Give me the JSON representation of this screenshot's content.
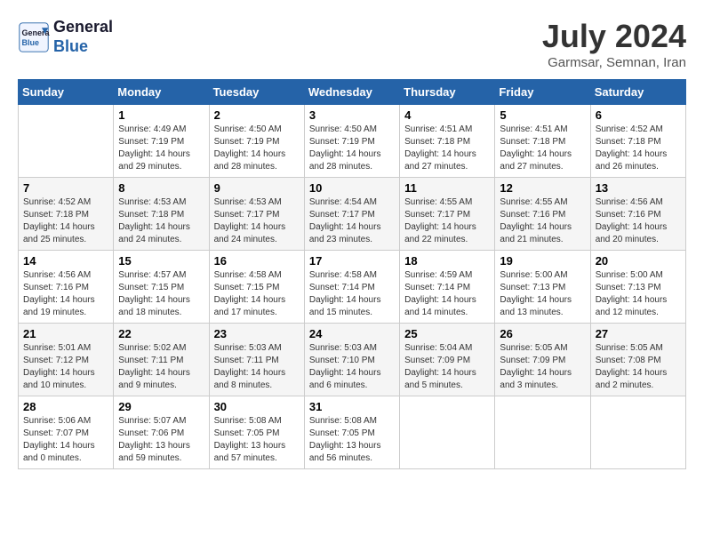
{
  "header": {
    "logo_line1": "General",
    "logo_line2": "Blue",
    "month_title": "July 2024",
    "location": "Garmsar, Semnan, Iran"
  },
  "weekdays": [
    "Sunday",
    "Monday",
    "Tuesday",
    "Wednesday",
    "Thursday",
    "Friday",
    "Saturday"
  ],
  "weeks": [
    [
      {
        "day": "",
        "info": ""
      },
      {
        "day": "1",
        "info": "Sunrise: 4:49 AM\nSunset: 7:19 PM\nDaylight: 14 hours\nand 29 minutes."
      },
      {
        "day": "2",
        "info": "Sunrise: 4:50 AM\nSunset: 7:19 PM\nDaylight: 14 hours\nand 28 minutes."
      },
      {
        "day": "3",
        "info": "Sunrise: 4:50 AM\nSunset: 7:19 PM\nDaylight: 14 hours\nand 28 minutes."
      },
      {
        "day": "4",
        "info": "Sunrise: 4:51 AM\nSunset: 7:18 PM\nDaylight: 14 hours\nand 27 minutes."
      },
      {
        "day": "5",
        "info": "Sunrise: 4:51 AM\nSunset: 7:18 PM\nDaylight: 14 hours\nand 27 minutes."
      },
      {
        "day": "6",
        "info": "Sunrise: 4:52 AM\nSunset: 7:18 PM\nDaylight: 14 hours\nand 26 minutes."
      }
    ],
    [
      {
        "day": "7",
        "info": "Sunrise: 4:52 AM\nSunset: 7:18 PM\nDaylight: 14 hours\nand 25 minutes."
      },
      {
        "day": "8",
        "info": "Sunrise: 4:53 AM\nSunset: 7:18 PM\nDaylight: 14 hours\nand 24 minutes."
      },
      {
        "day": "9",
        "info": "Sunrise: 4:53 AM\nSunset: 7:17 PM\nDaylight: 14 hours\nand 24 minutes."
      },
      {
        "day": "10",
        "info": "Sunrise: 4:54 AM\nSunset: 7:17 PM\nDaylight: 14 hours\nand 23 minutes."
      },
      {
        "day": "11",
        "info": "Sunrise: 4:55 AM\nSunset: 7:17 PM\nDaylight: 14 hours\nand 22 minutes."
      },
      {
        "day": "12",
        "info": "Sunrise: 4:55 AM\nSunset: 7:16 PM\nDaylight: 14 hours\nand 21 minutes."
      },
      {
        "day": "13",
        "info": "Sunrise: 4:56 AM\nSunset: 7:16 PM\nDaylight: 14 hours\nand 20 minutes."
      }
    ],
    [
      {
        "day": "14",
        "info": "Sunrise: 4:56 AM\nSunset: 7:16 PM\nDaylight: 14 hours\nand 19 minutes."
      },
      {
        "day": "15",
        "info": "Sunrise: 4:57 AM\nSunset: 7:15 PM\nDaylight: 14 hours\nand 18 minutes."
      },
      {
        "day": "16",
        "info": "Sunrise: 4:58 AM\nSunset: 7:15 PM\nDaylight: 14 hours\nand 17 minutes."
      },
      {
        "day": "17",
        "info": "Sunrise: 4:58 AM\nSunset: 7:14 PM\nDaylight: 14 hours\nand 15 minutes."
      },
      {
        "day": "18",
        "info": "Sunrise: 4:59 AM\nSunset: 7:14 PM\nDaylight: 14 hours\nand 14 minutes."
      },
      {
        "day": "19",
        "info": "Sunrise: 5:00 AM\nSunset: 7:13 PM\nDaylight: 14 hours\nand 13 minutes."
      },
      {
        "day": "20",
        "info": "Sunrise: 5:00 AM\nSunset: 7:13 PM\nDaylight: 14 hours\nand 12 minutes."
      }
    ],
    [
      {
        "day": "21",
        "info": "Sunrise: 5:01 AM\nSunset: 7:12 PM\nDaylight: 14 hours\nand 10 minutes."
      },
      {
        "day": "22",
        "info": "Sunrise: 5:02 AM\nSunset: 7:11 PM\nDaylight: 14 hours\nand 9 minutes."
      },
      {
        "day": "23",
        "info": "Sunrise: 5:03 AM\nSunset: 7:11 PM\nDaylight: 14 hours\nand 8 minutes."
      },
      {
        "day": "24",
        "info": "Sunrise: 5:03 AM\nSunset: 7:10 PM\nDaylight: 14 hours\nand 6 minutes."
      },
      {
        "day": "25",
        "info": "Sunrise: 5:04 AM\nSunset: 7:09 PM\nDaylight: 14 hours\nand 5 minutes."
      },
      {
        "day": "26",
        "info": "Sunrise: 5:05 AM\nSunset: 7:09 PM\nDaylight: 14 hours\nand 3 minutes."
      },
      {
        "day": "27",
        "info": "Sunrise: 5:05 AM\nSunset: 7:08 PM\nDaylight: 14 hours\nand 2 minutes."
      }
    ],
    [
      {
        "day": "28",
        "info": "Sunrise: 5:06 AM\nSunset: 7:07 PM\nDaylight: 14 hours\nand 0 minutes."
      },
      {
        "day": "29",
        "info": "Sunrise: 5:07 AM\nSunset: 7:06 PM\nDaylight: 13 hours\nand 59 minutes."
      },
      {
        "day": "30",
        "info": "Sunrise: 5:08 AM\nSunset: 7:05 PM\nDaylight: 13 hours\nand 57 minutes."
      },
      {
        "day": "31",
        "info": "Sunrise: 5:08 AM\nSunset: 7:05 PM\nDaylight: 13 hours\nand 56 minutes."
      },
      {
        "day": "",
        "info": ""
      },
      {
        "day": "",
        "info": ""
      },
      {
        "day": "",
        "info": ""
      }
    ]
  ]
}
